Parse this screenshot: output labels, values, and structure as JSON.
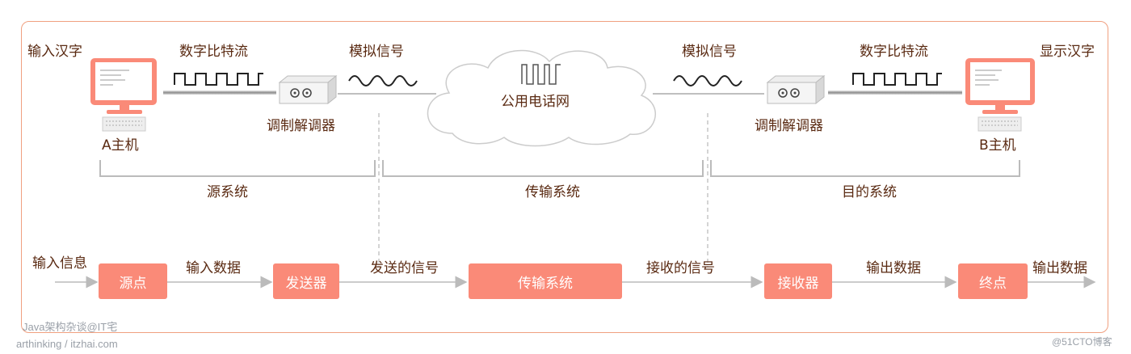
{
  "colors": {
    "accent": "#fa8a78",
    "frame": "#f0a080",
    "text": "#5a2a12",
    "line": "#aaaaaa"
  },
  "top": {
    "input_hanzi": "输入汉字",
    "display_hanzi": "显示汉字",
    "digital_bitstream_left": "数字比特流",
    "digital_bitstream_right": "数字比特流",
    "analog_left": "模拟信号",
    "analog_right": "模拟信号",
    "modem_left": "调制解调器",
    "modem_right": "调制解调器",
    "host_a": "A主机",
    "host_b": "B主机",
    "cloud": "公用电话网",
    "source_system": "源系统",
    "transmission_system": "传输系统",
    "destination_system": "目的系统"
  },
  "bottom": {
    "input_info": "输入信息",
    "source": "源点",
    "input_data": "输入数据",
    "transmitter": "发送器",
    "sent_signal": "发送的信号",
    "transmission": "传输系统",
    "received_signal": "接收的信号",
    "receiver": "接收器",
    "output_data_1": "输出数据",
    "sink": "终点",
    "output_data_2": "输出数据"
  },
  "watermarks": {
    "wm1": "Java架构杂谈@IT宅",
    "wm2": "arthinking / itzhai.com",
    "wm3": "@51CTO博客"
  },
  "icons": [
    "computer-icon",
    "keyboard-icon",
    "modem-icon",
    "square-wave-icon",
    "sine-wave-icon",
    "cloud-icon"
  ]
}
